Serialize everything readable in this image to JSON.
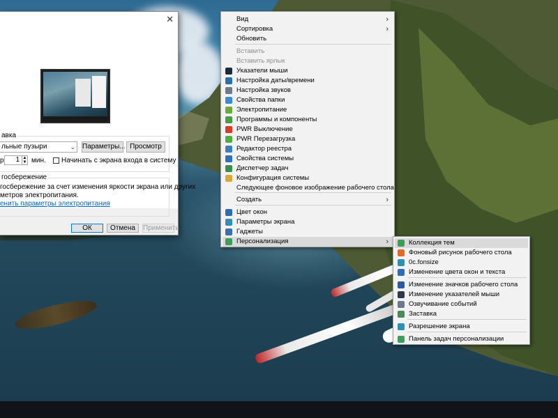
{
  "dialog": {
    "screensaver_group_label": "авка",
    "screensaver_select_value": "льные пузыри",
    "params_button": "Параметры...",
    "preview_button": "Просмотр",
    "interval_prefix": "р",
    "interval_value": "1",
    "interval_unit": "мин.",
    "logon_checkbox_label": "Начинать с экрана входа в систему",
    "power_group_label": "госбережение",
    "power_text_line1": "госбережение за счет изменения яркости экрана или других",
    "power_text_line2": "метров электропитания.",
    "power_link": "енить параметры электропитания",
    "ok_button": "ОК",
    "cancel_button": "Отмена",
    "apply_button": "Применить",
    "close_glyph": "✕"
  },
  "context_menu": {
    "items": [
      {
        "label": "Вид",
        "submenu": true
      },
      {
        "label": "Сортировка",
        "submenu": true
      },
      {
        "label": "Обновить"
      },
      {
        "label": "Вставить",
        "disabled": true
      },
      {
        "label": "Вставить ярлык",
        "disabled": true
      },
      {
        "label": "Указатели мыши",
        "icon": "mouse-pointer-icon",
        "color": "#1c2b3a"
      },
      {
        "label": "Настройка даты/времени",
        "icon": "clock-icon",
        "color": "#2e6fa8"
      },
      {
        "label": "Настройка звуков",
        "icon": "speaker-icon",
        "color": "#6b7b8c"
      },
      {
        "label": "Свойства папки",
        "icon": "folder-options-icon",
        "color": "#3b8dd0"
      },
      {
        "label": "Электропитание",
        "icon": "power-options-icon",
        "color": "#6fa83c"
      },
      {
        "label": "Программы и компоненты",
        "icon": "programs-icon",
        "color": "#4a9c46"
      },
      {
        "label": "PWR Выключение",
        "icon": "shutdown-icon",
        "color": "#d93a2b"
      },
      {
        "label": "PWR Перезагрузка",
        "icon": "restart-icon",
        "color": "#4fae3f"
      },
      {
        "label": "Редактор реестра",
        "icon": "registry-icon",
        "color": "#3f7fbf"
      },
      {
        "label": "Свойства системы",
        "icon": "system-icon",
        "color": "#2f6fb5"
      },
      {
        "label": "Диспетчер задач",
        "icon": "task-manager-icon",
        "color": "#3c8c4c"
      },
      {
        "label": "Конфигурация системы",
        "icon": "msconfig-icon",
        "color": "#d9a93a"
      },
      {
        "label": "Следующее фоновое изображение рабочего стола"
      },
      {
        "label": "Создать",
        "submenu": true
      },
      {
        "label": "Цвет окон",
        "icon": "window-color-icon",
        "color": "#2d6db5"
      },
      {
        "label": "Параметры экрана",
        "icon": "display-icon",
        "color": "#2f8fb5"
      },
      {
        "label": "Гаджеты",
        "icon": "gadgets-icon",
        "color": "#3a6fb0"
      },
      {
        "label": "Персонализация",
        "icon": "personalization-icon",
        "color": "#3e9d5a",
        "submenu": true,
        "highlighted": true
      }
    ]
  },
  "submenu": {
    "items": [
      {
        "label": "Коллекция тем",
        "icon": "themes-icon",
        "color": "#3e9d5a",
        "highlighted": true
      },
      {
        "label": "Фоновый рисунок рабочего стола",
        "icon": "wallpaper-icon",
        "color": "#e26b2a"
      },
      {
        "label": "0c.fonsize",
        "icon": "font-size-icon",
        "color": "#2f8fb5"
      },
      {
        "label": "Изменение цвета окон и текста",
        "icon": "window-color-icon",
        "color": "#2d6db5"
      },
      {
        "label": "Изменение значков рабочего стола",
        "icon": "desktop-icons-icon",
        "color": "#2a5aa0"
      },
      {
        "label": "Изменение указателей мыши",
        "icon": "mouse-pointer-icon",
        "color": "#2b3b4c"
      },
      {
        "label": "Озвучивание событий",
        "icon": "speaker-icon",
        "color": "#6b7b8c"
      },
      {
        "label": "Заставка",
        "icon": "screensaver-icon",
        "color": "#4a8a5c"
      },
      {
        "label": "Разрешение экрана",
        "icon": "display-icon",
        "color": "#2f8fb5"
      },
      {
        "label": "Панель задач персонализации",
        "icon": "taskbar-icon",
        "color": "#3e9d5a"
      }
    ]
  }
}
